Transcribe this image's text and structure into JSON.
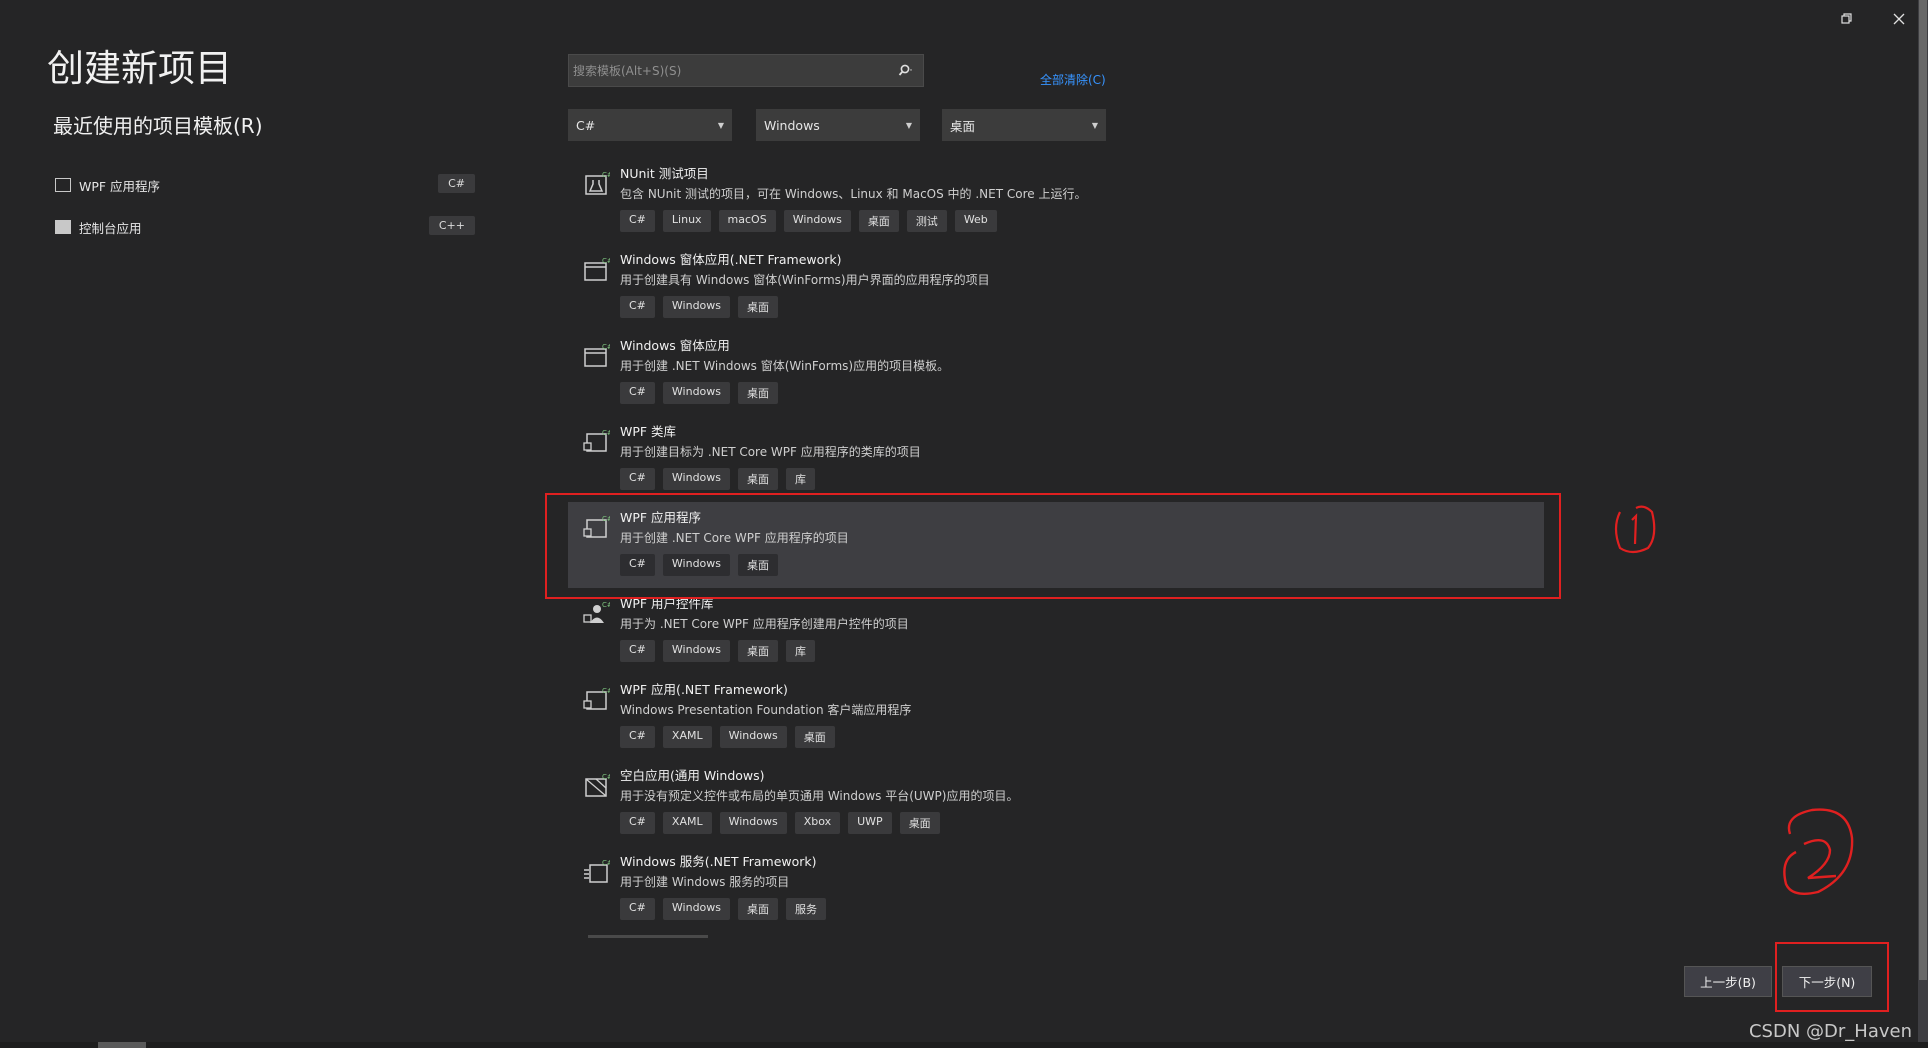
{
  "window": {
    "restore_icon": "restore-icon",
    "close_icon": "close-icon"
  },
  "page": {
    "title": "创建新项目",
    "recent_heading": "最近使用的项目模板(R)"
  },
  "recent": [
    {
      "label": "WPF 应用程序",
      "lang": "C#",
      "icon": "wpf-app-icon"
    },
    {
      "label": "控制台应用",
      "lang": "C++",
      "icon": "console-app-icon"
    }
  ],
  "search": {
    "placeholder": "搜索模板(Alt+S)(S)",
    "icon": "search-icon"
  },
  "clear_all": "全部清除(C)",
  "filters": [
    {
      "value": "C#"
    },
    {
      "value": "Windows"
    },
    {
      "value": "桌面"
    }
  ],
  "templates": [
    {
      "name": "NUnit 测试项目",
      "desc": "包含 NUnit 测试的项目，可在 Windows、Linux 和 MacOS 中的 .NET Core 上运行。",
      "tags": [
        "C#",
        "Linux",
        "macOS",
        "Windows",
        "桌面",
        "测试",
        "Web"
      ],
      "icon": "test-project-icon"
    },
    {
      "name": "Windows 窗体应用(.NET Framework)",
      "desc": "用于创建具有 Windows 窗体(WinForms)用户界面的应用程序的项目",
      "tags": [
        "C#",
        "Windows",
        "桌面"
      ],
      "icon": "winforms-icon"
    },
    {
      "name": "Windows 窗体应用",
      "desc": "用于创建 .NET Windows 窗体(WinForms)应用的项目模板。",
      "tags": [
        "C#",
        "Windows",
        "桌面"
      ],
      "icon": "winforms-icon"
    },
    {
      "name": "WPF 类库",
      "desc": "用于创建目标为 .NET Core WPF 应用程序的类库的项目",
      "tags": [
        "C#",
        "Windows",
        "桌面",
        "库"
      ],
      "icon": "wpf-library-icon"
    },
    {
      "name": "WPF 应用程序",
      "desc": "用于创建 .NET Core WPF 应用程序的项目",
      "tags": [
        "C#",
        "Windows",
        "桌面"
      ],
      "icon": "wpf-app-icon",
      "selected": true
    },
    {
      "name": "WPF 用户控件库",
      "desc": "用于为 .NET Core WPF 应用程序创建用户控件的项目",
      "tags": [
        "C#",
        "Windows",
        "桌面",
        "库"
      ],
      "icon": "wpf-usercontrol-icon"
    },
    {
      "name": "WPF 应用(.NET Framework)",
      "desc": "Windows Presentation Foundation 客户端应用程序",
      "tags": [
        "C#",
        "XAML",
        "Windows",
        "桌面"
      ],
      "icon": "wpf-app-icon"
    },
    {
      "name": "空白应用(通用 Windows)",
      "desc": "用于没有预定义控件或布局的单页通用 Windows 平台(UWP)应用的项目。",
      "tags": [
        "C#",
        "XAML",
        "Windows",
        "Xbox",
        "UWP",
        "桌面"
      ],
      "icon": "uwp-app-icon"
    },
    {
      "name": "Windows 服务(.NET Framework)",
      "desc": "用于创建 Windows 服务的项目",
      "tags": [
        "C#",
        "Windows",
        "桌面",
        "服务"
      ],
      "icon": "windows-service-icon"
    }
  ],
  "buttons": {
    "back": "上一步(B)",
    "next": "下一步(N)"
  },
  "annotations": {
    "mark_1": "1",
    "mark_2": "2",
    "highlight_color": "#e02020"
  },
  "watermark": "CSDN @Dr_Haven"
}
